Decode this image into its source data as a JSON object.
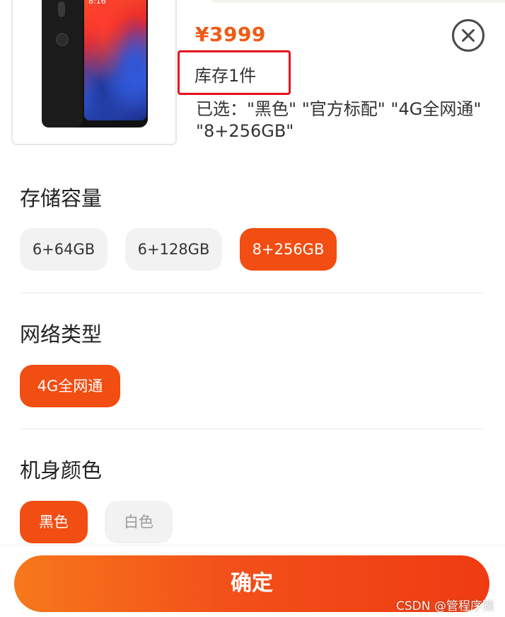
{
  "product": {
    "price": "¥3999",
    "stock": "库存1件",
    "selected_line1": "已选：\"黑色\" \"官方标配\" \"4G全网通\"",
    "selected_line2": "\"8+256GB\"",
    "phone_time": "8:16"
  },
  "sections": {
    "storage": {
      "title": "存储容量",
      "options": [
        "6+64GB",
        "6+128GB",
        "8+256GB"
      ],
      "selected": "8+256GB"
    },
    "network": {
      "title": "网络类型",
      "options": [
        "4G全网通"
      ],
      "selected": "4G全网通"
    },
    "color": {
      "title": "机身颜色",
      "options": [
        "黑色",
        "白色"
      ],
      "selected": "黑色",
      "disabled": [
        "白色"
      ]
    }
  },
  "actions": {
    "confirm_label": "确定"
  },
  "watermark": "CSDN @管程序猿",
  "colors": {
    "accent": "#f24d12",
    "price": "#f05a14",
    "highlight_box": "#e4121e"
  },
  "icons": {
    "close": "close-circle-icon"
  }
}
